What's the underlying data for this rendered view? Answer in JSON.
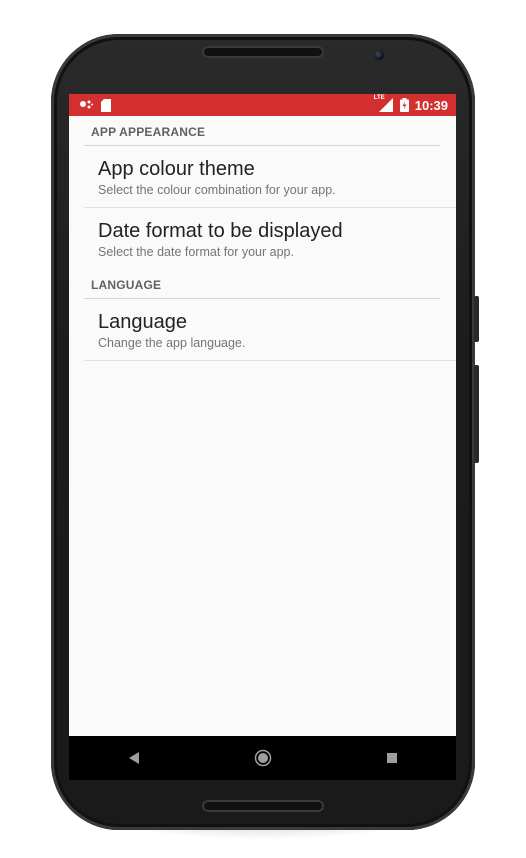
{
  "status_bar": {
    "time": "10:39",
    "network_label": "LTE",
    "left_icons": [
      "dots-icon",
      "sd-card-icon"
    ],
    "right_icons": [
      "signal-icon",
      "battery-icon"
    ],
    "background_color": "#d32f2f"
  },
  "sections": [
    {
      "header": "APP APPEARANCE",
      "items": [
        {
          "title": "App colour theme",
          "summary": "Select the colour combination for your app."
        },
        {
          "title": "Date format to be displayed",
          "summary": "Select the date format for your app."
        }
      ]
    },
    {
      "header": "LANGUAGE",
      "items": [
        {
          "title": "Language",
          "summary": "Change the app language."
        }
      ]
    }
  ],
  "navigation": [
    "back-icon",
    "home-icon",
    "recents-icon"
  ]
}
